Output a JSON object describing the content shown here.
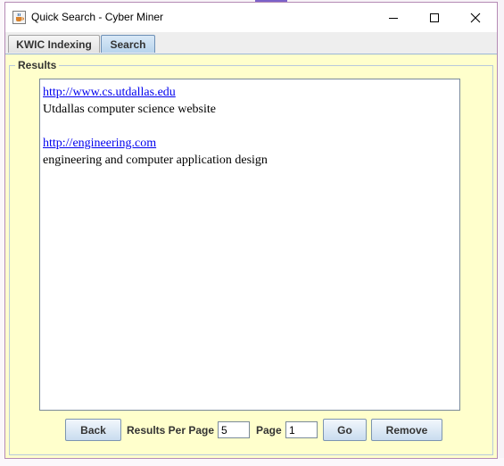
{
  "window": {
    "title": "Quick Search - Cyber Miner",
    "icon": "java-cup-icon"
  },
  "tabs": [
    {
      "label": "KWIC Indexing",
      "selected": false
    },
    {
      "label": "Search",
      "selected": true
    }
  ],
  "results_panel": {
    "title": "Results",
    "items": [
      {
        "url": "http://www.cs.utdallas.edu",
        "description": "Utdallas computer science website"
      },
      {
        "url": "http://engineering.com",
        "description": "engineering and computer application design"
      }
    ]
  },
  "controls": {
    "back_label": "Back",
    "results_per_page_label": "Results Per Page",
    "results_per_page_value": "5",
    "page_label": "Page",
    "page_value": "1",
    "go_label": "Go",
    "remove_label": "Remove"
  },
  "colors": {
    "content_background": "#ffffcc",
    "link": "#0000ee",
    "selected_tab": "#b8d3ec"
  }
}
